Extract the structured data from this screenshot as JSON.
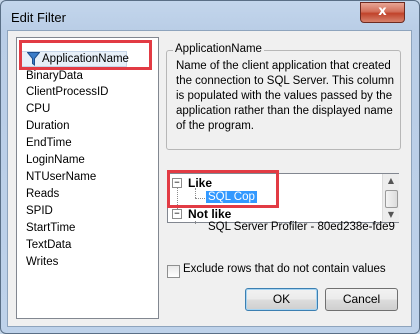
{
  "window": {
    "title": "Edit Filter",
    "close_label": "x"
  },
  "field_list": {
    "selected": "ApplicationName",
    "items": [
      "BinaryData",
      "ClientProcessID",
      "CPU",
      "Duration",
      "EndTime",
      "LoginName",
      "NTUserName",
      "Reads",
      "SPID",
      "StartTime",
      "TextData",
      "Writes"
    ]
  },
  "description": {
    "title": "ApplicationName",
    "text": "Name of the client application that created the connection to SQL Server. This column is populated with the values passed by the application rather than the displayed name of the program."
  },
  "tree": {
    "nodes": [
      {
        "label": "Like",
        "toggle": "−",
        "children": [
          "SQL Cop"
        ]
      },
      {
        "label": "Not like",
        "toggle": "−",
        "children": [
          "SQL Server Profiler - 80ed238e-fde9"
        ]
      }
    ]
  },
  "checkbox": {
    "label": "Exclude rows that do not contain values",
    "checked": false
  },
  "buttons": {
    "ok": "OK",
    "cancel": "Cancel"
  },
  "colors": {
    "highlight_box": "#e23b44",
    "selection": "#3399ff"
  },
  "icons": {
    "selected_field": "funnel-icon"
  }
}
